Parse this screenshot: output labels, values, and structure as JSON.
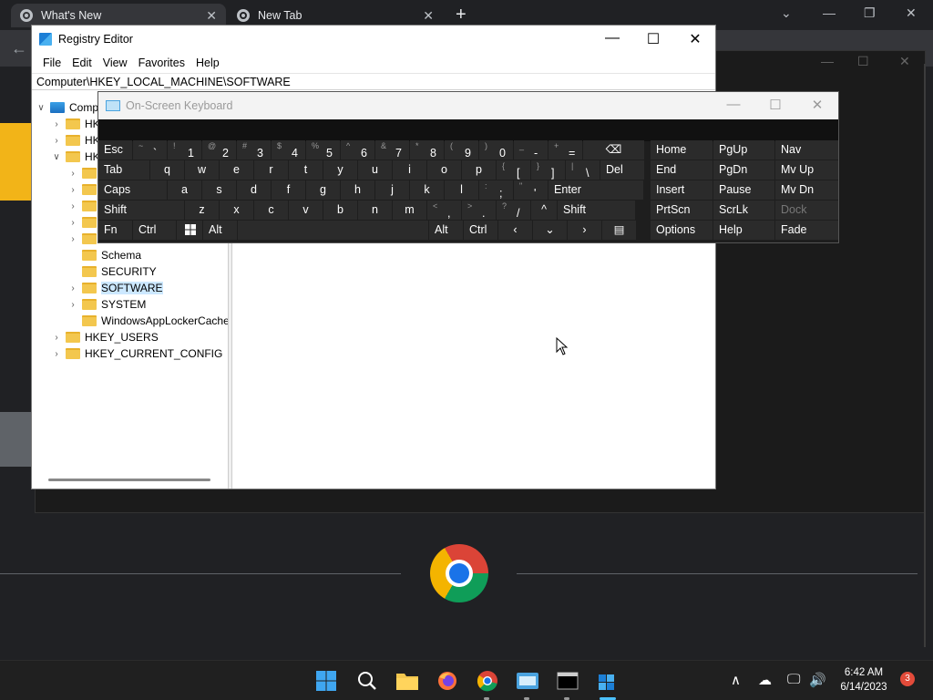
{
  "chrome": {
    "tabs": [
      {
        "label": "What's New",
        "close": "✕"
      },
      {
        "label": "New Tab",
        "close": "✕"
      }
    ],
    "new_tab": "+",
    "controls": {
      "minimize": "⌄",
      "min2": "—",
      "restore": "❐",
      "close": "✕"
    },
    "back": "←"
  },
  "regedit": {
    "title": "Registry Editor",
    "controls": {
      "minimize": "—",
      "maximize": "☐",
      "close": "✕"
    },
    "menu": [
      "File",
      "Edit",
      "View",
      "Favorites",
      "Help"
    ],
    "address": "Computer\\HKEY_LOCAL_MACHINE\\SOFTWARE",
    "tree": [
      {
        "label": "Comp",
        "chev": "∨",
        "level": 0,
        "icon": "computer"
      },
      {
        "label": "HK",
        "chev": "›",
        "level": 1,
        "icon": "folder"
      },
      {
        "label": "HK",
        "chev": "›",
        "level": 1,
        "icon": "folder"
      },
      {
        "label": "HK",
        "chev": "∨",
        "level": 1,
        "icon": "folder"
      },
      {
        "label": "",
        "chev": "›",
        "level": 2,
        "icon": "folder"
      },
      {
        "label": "",
        "chev": "›",
        "level": 2,
        "icon": "folder"
      },
      {
        "label": "",
        "chev": "›",
        "level": 2,
        "icon": "folder"
      },
      {
        "label": "",
        "chev": "›",
        "level": 2,
        "icon": "folder"
      },
      {
        "label": "",
        "chev": "›",
        "level": 2,
        "icon": "folder"
      },
      {
        "label": "Schema",
        "chev": "",
        "level": 2,
        "icon": "folder"
      },
      {
        "label": "SECURITY",
        "chev": "",
        "level": 2,
        "icon": "folder"
      },
      {
        "label": "SOFTWARE",
        "chev": "›",
        "level": 2,
        "icon": "folder",
        "selected": true
      },
      {
        "label": "SYSTEM",
        "chev": "›",
        "level": 2,
        "icon": "folder"
      },
      {
        "label": "WindowsAppLockerCache",
        "chev": "",
        "level": 2,
        "icon": "folder"
      },
      {
        "label": "HKEY_USERS",
        "chev": "›",
        "level": 1,
        "icon": "folder"
      },
      {
        "label": "HKEY_CURRENT_CONFIG",
        "chev": "›",
        "level": 1,
        "icon": "folder"
      }
    ]
  },
  "osk": {
    "title": "On-Screen Keyboard",
    "controls": {
      "minimize": "—",
      "maximize": "☐",
      "close": "✕"
    },
    "rows": [
      [
        {
          "main": "Esc",
          "w": 37
        },
        {
          "shift": "~",
          "main": "`",
          "w": 37
        },
        {
          "shift": "!",
          "main": "1",
          "w": 37
        },
        {
          "shift": "@",
          "main": "2",
          "w": 37
        },
        {
          "shift": "#",
          "main": "3",
          "w": 37
        },
        {
          "shift": "$",
          "main": "4",
          "w": 37
        },
        {
          "shift": "%",
          "main": "5",
          "w": 37
        },
        {
          "shift": "^",
          "main": "6",
          "w": 37
        },
        {
          "shift": "&",
          "main": "7",
          "w": 37
        },
        {
          "shift": "*",
          "main": "8",
          "w": 37
        },
        {
          "shift": "(",
          "main": "9",
          "w": 37
        },
        {
          "shift": ")",
          "main": "0",
          "w": 37
        },
        {
          "shift": "_",
          "main": "-",
          "w": 37
        },
        {
          "shift": "+",
          "main": "=",
          "w": 37
        },
        {
          "main": "⌫",
          "w": 67
        }
      ],
      [
        {
          "main": "Tab",
          "w": 56
        },
        {
          "main": "q",
          "w": 37
        },
        {
          "main": "w",
          "w": 37
        },
        {
          "main": "e",
          "w": 37
        },
        {
          "main": "r",
          "w": 37
        },
        {
          "main": "t",
          "w": 37
        },
        {
          "main": "y",
          "w": 37
        },
        {
          "main": "u",
          "w": 37
        },
        {
          "main": "i",
          "w": 37
        },
        {
          "main": "o",
          "w": 37
        },
        {
          "main": "p",
          "w": 37
        },
        {
          "shift": "{",
          "main": "[",
          "w": 37
        },
        {
          "shift": "}",
          "main": "]",
          "w": 37
        },
        {
          "shift": "|",
          "main": "\\",
          "w": 37
        },
        {
          "main": "Del",
          "w": 48
        }
      ],
      [
        {
          "main": "Caps",
          "w": 75
        },
        {
          "main": "a",
          "w": 37
        },
        {
          "main": "s",
          "w": 37
        },
        {
          "main": "d",
          "w": 37
        },
        {
          "main": "f",
          "w": 37
        },
        {
          "main": "g",
          "w": 37
        },
        {
          "main": "h",
          "w": 37
        },
        {
          "main": "j",
          "w": 37
        },
        {
          "main": "k",
          "w": 37
        },
        {
          "main": "l",
          "w": 37
        },
        {
          "shift": ":",
          "main": ";",
          "w": 37
        },
        {
          "shift": "\"",
          "main": "'",
          "w": 37
        },
        {
          "main": "Enter",
          "w": 104
        }
      ],
      [
        {
          "main": "Shift",
          "w": 94
        },
        {
          "main": "z",
          "w": 37
        },
        {
          "main": "x",
          "w": 37
        },
        {
          "main": "c",
          "w": 37
        },
        {
          "main": "v",
          "w": 37
        },
        {
          "main": "b",
          "w": 37
        },
        {
          "main": "n",
          "w": 37
        },
        {
          "main": "m",
          "w": 37
        },
        {
          "shift": "<",
          "main": ",",
          "w": 37
        },
        {
          "shift": ">",
          "main": ".",
          "w": 37
        },
        {
          "shift": "?",
          "main": "/",
          "w": 37
        },
        {
          "main": "^",
          "w": 28
        },
        {
          "main": "Shift",
          "w": 85
        }
      ],
      [
        {
          "main": "Fn",
          "w": 37
        },
        {
          "main": "Ctrl",
          "w": 47
        },
        {
          "main": "win",
          "w": 28
        },
        {
          "main": "Alt",
          "w": 37
        },
        {
          "main": "",
          "w": 209
        },
        {
          "main": "Alt",
          "w": 37
        },
        {
          "main": "Ctrl",
          "w": 37
        },
        {
          "main": "‹",
          "w": 37
        },
        {
          "main": "⌄",
          "w": 37
        },
        {
          "main": "›",
          "w": 37
        },
        {
          "main": "▤",
          "w": 37
        }
      ]
    ],
    "nav_rows": [
      [
        "Home",
        "PgUp",
        "Nav"
      ],
      [
        "End",
        "PgDn",
        "Mv Up"
      ],
      [
        "Insert",
        "Pause",
        "Mv Dn"
      ],
      [
        "PrtScn",
        "ScrLk",
        "Dock"
      ],
      [
        "Options",
        "Help",
        "Fade"
      ]
    ]
  },
  "taskbar": {
    "time": "6:42 AM",
    "date": "6/14/2023",
    "badge": "3",
    "tray": {
      "chevron": "∧",
      "cloud": "☁",
      "monitor": "🖵",
      "volume": "🔊"
    }
  }
}
